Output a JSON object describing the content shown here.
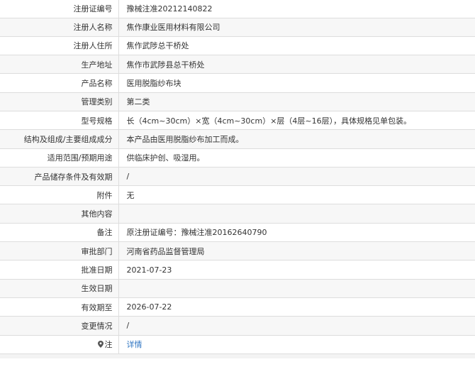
{
  "rows": [
    {
      "label": "注册证编号",
      "value": "豫械注准20212140822"
    },
    {
      "label": "注册人名称",
      "value": "焦作康业医用材料有限公司"
    },
    {
      "label": "注册人住所",
      "value": "焦作武陟总干桥处"
    },
    {
      "label": "生产地址",
      "value": "焦作市武陟县总干桥处"
    },
    {
      "label": "产品名称",
      "value": "医用脱脂纱布块"
    },
    {
      "label": "管理类别",
      "value": "第二类"
    },
    {
      "label": "型号规格",
      "value": "长（4cm~30cm）×宽（4cm~30cm）×层（4层~16层），具体规格见单包装。"
    },
    {
      "label": "结构及组成/主要组成成分",
      "value": "本产品由医用脱脂纱布加工而成。"
    },
    {
      "label": "适用范围/预期用途",
      "value": "供临床护创、吸湿用。"
    },
    {
      "label": "产品储存条件及有效期",
      "value": "/"
    },
    {
      "label": "附件",
      "value": "无"
    },
    {
      "label": "其他内容",
      "value": ""
    },
    {
      "label": "备注",
      "value": "原注册证编号：豫械注准20162640790"
    },
    {
      "label": "审批部门",
      "value": "河南省药品监督管理局"
    },
    {
      "label": "批准日期",
      "value": "2021-07-23"
    },
    {
      "label": "生效日期",
      "value": ""
    },
    {
      "label": "有效期至",
      "value": "2026-07-22"
    },
    {
      "label": "变更情况",
      "value": "/"
    }
  ],
  "note_row": {
    "icon": "pin-icon",
    "label": "注",
    "link_text": "详情"
  }
}
